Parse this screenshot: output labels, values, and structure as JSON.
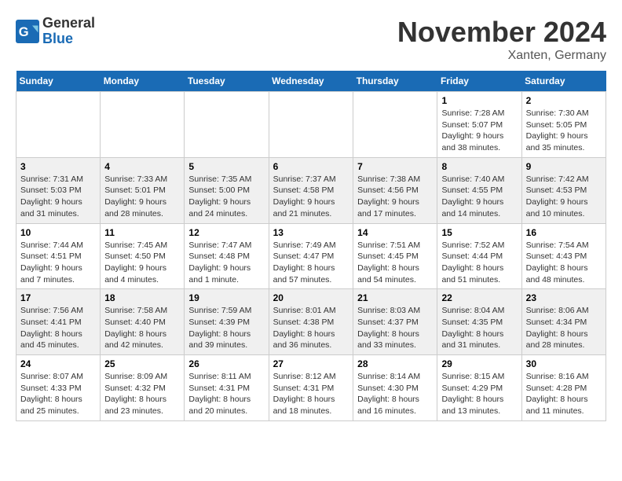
{
  "header": {
    "logo_general": "General",
    "logo_blue": "Blue",
    "title": "November 2024",
    "subtitle": "Xanten, Germany"
  },
  "weekdays": [
    "Sunday",
    "Monday",
    "Tuesday",
    "Wednesday",
    "Thursday",
    "Friday",
    "Saturday"
  ],
  "weeks": [
    [
      {
        "day": "",
        "info": ""
      },
      {
        "day": "",
        "info": ""
      },
      {
        "day": "",
        "info": ""
      },
      {
        "day": "",
        "info": ""
      },
      {
        "day": "",
        "info": ""
      },
      {
        "day": "1",
        "info": "Sunrise: 7:28 AM\nSunset: 5:07 PM\nDaylight: 9 hours\nand 38 minutes."
      },
      {
        "day": "2",
        "info": "Sunrise: 7:30 AM\nSunset: 5:05 PM\nDaylight: 9 hours\nand 35 minutes."
      }
    ],
    [
      {
        "day": "3",
        "info": "Sunrise: 7:31 AM\nSunset: 5:03 PM\nDaylight: 9 hours\nand 31 minutes."
      },
      {
        "day": "4",
        "info": "Sunrise: 7:33 AM\nSunset: 5:01 PM\nDaylight: 9 hours\nand 28 minutes."
      },
      {
        "day": "5",
        "info": "Sunrise: 7:35 AM\nSunset: 5:00 PM\nDaylight: 9 hours\nand 24 minutes."
      },
      {
        "day": "6",
        "info": "Sunrise: 7:37 AM\nSunset: 4:58 PM\nDaylight: 9 hours\nand 21 minutes."
      },
      {
        "day": "7",
        "info": "Sunrise: 7:38 AM\nSunset: 4:56 PM\nDaylight: 9 hours\nand 17 minutes."
      },
      {
        "day": "8",
        "info": "Sunrise: 7:40 AM\nSunset: 4:55 PM\nDaylight: 9 hours\nand 14 minutes."
      },
      {
        "day": "9",
        "info": "Sunrise: 7:42 AM\nSunset: 4:53 PM\nDaylight: 9 hours\nand 10 minutes."
      }
    ],
    [
      {
        "day": "10",
        "info": "Sunrise: 7:44 AM\nSunset: 4:51 PM\nDaylight: 9 hours\nand 7 minutes."
      },
      {
        "day": "11",
        "info": "Sunrise: 7:45 AM\nSunset: 4:50 PM\nDaylight: 9 hours\nand 4 minutes."
      },
      {
        "day": "12",
        "info": "Sunrise: 7:47 AM\nSunset: 4:48 PM\nDaylight: 9 hours\nand 1 minute."
      },
      {
        "day": "13",
        "info": "Sunrise: 7:49 AM\nSunset: 4:47 PM\nDaylight: 8 hours\nand 57 minutes."
      },
      {
        "day": "14",
        "info": "Sunrise: 7:51 AM\nSunset: 4:45 PM\nDaylight: 8 hours\nand 54 minutes."
      },
      {
        "day": "15",
        "info": "Sunrise: 7:52 AM\nSunset: 4:44 PM\nDaylight: 8 hours\nand 51 minutes."
      },
      {
        "day": "16",
        "info": "Sunrise: 7:54 AM\nSunset: 4:43 PM\nDaylight: 8 hours\nand 48 minutes."
      }
    ],
    [
      {
        "day": "17",
        "info": "Sunrise: 7:56 AM\nSunset: 4:41 PM\nDaylight: 8 hours\nand 45 minutes."
      },
      {
        "day": "18",
        "info": "Sunrise: 7:58 AM\nSunset: 4:40 PM\nDaylight: 8 hours\nand 42 minutes."
      },
      {
        "day": "19",
        "info": "Sunrise: 7:59 AM\nSunset: 4:39 PM\nDaylight: 8 hours\nand 39 minutes."
      },
      {
        "day": "20",
        "info": "Sunrise: 8:01 AM\nSunset: 4:38 PM\nDaylight: 8 hours\nand 36 minutes."
      },
      {
        "day": "21",
        "info": "Sunrise: 8:03 AM\nSunset: 4:37 PM\nDaylight: 8 hours\nand 33 minutes."
      },
      {
        "day": "22",
        "info": "Sunrise: 8:04 AM\nSunset: 4:35 PM\nDaylight: 8 hours\nand 31 minutes."
      },
      {
        "day": "23",
        "info": "Sunrise: 8:06 AM\nSunset: 4:34 PM\nDaylight: 8 hours\nand 28 minutes."
      }
    ],
    [
      {
        "day": "24",
        "info": "Sunrise: 8:07 AM\nSunset: 4:33 PM\nDaylight: 8 hours\nand 25 minutes."
      },
      {
        "day": "25",
        "info": "Sunrise: 8:09 AM\nSunset: 4:32 PM\nDaylight: 8 hours\nand 23 minutes."
      },
      {
        "day": "26",
        "info": "Sunrise: 8:11 AM\nSunset: 4:31 PM\nDaylight: 8 hours\nand 20 minutes."
      },
      {
        "day": "27",
        "info": "Sunrise: 8:12 AM\nSunset: 4:31 PM\nDaylight: 8 hours\nand 18 minutes."
      },
      {
        "day": "28",
        "info": "Sunrise: 8:14 AM\nSunset: 4:30 PM\nDaylight: 8 hours\nand 16 minutes."
      },
      {
        "day": "29",
        "info": "Sunrise: 8:15 AM\nSunset: 4:29 PM\nDaylight: 8 hours\nand 13 minutes."
      },
      {
        "day": "30",
        "info": "Sunrise: 8:16 AM\nSunset: 4:28 PM\nDaylight: 8 hours\nand 11 minutes."
      }
    ]
  ]
}
